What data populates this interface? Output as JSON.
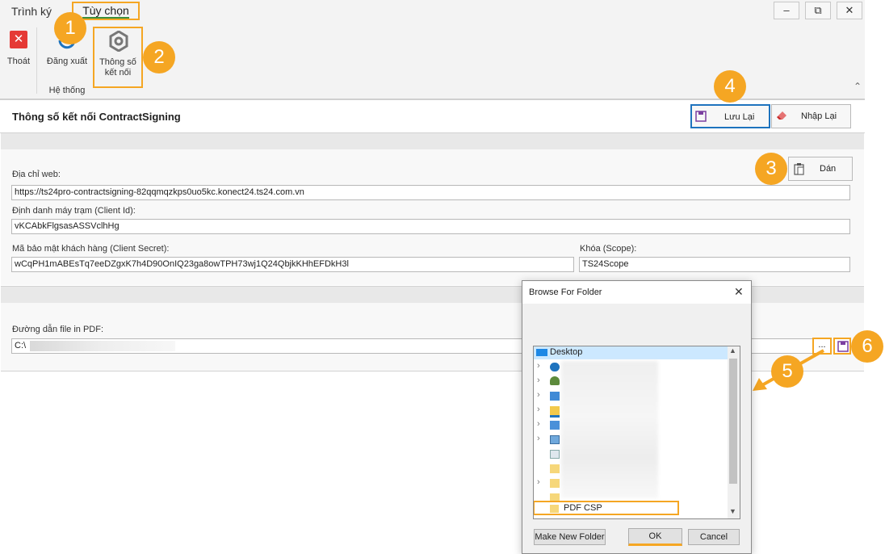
{
  "ribbon": {
    "tabs": [
      "Trình ký",
      "Tùy chọn"
    ],
    "exit_label": "Thoát",
    "logout_label": "Đăng xuất",
    "connection_label_line1": "Thông số",
    "connection_label_line2": "kết nối",
    "group_label": "Hệ thống",
    "window_buttons": [
      "–",
      "⧉",
      "✕"
    ],
    "collapse_glyph": "⌃"
  },
  "panel": {
    "title": "Thông số kết nối ContractSigning",
    "save_label": "Lưu Lại",
    "reset_label": "Nhập Lại",
    "paste_label": "Dán",
    "web_address_label": "Địa chỉ web:",
    "web_address_value": "https://ts24pro-contractsigning-82qqmqzkps0uo5kc.konect24.ts24.com.vn",
    "client_id_label": "Định danh máy trạm (Client Id):",
    "client_id_value": "vKCAbkFlgsasASSVclhHg",
    "client_secret_label": "Mã bảo mật khách hàng (Client Secret):",
    "client_secret_value": "wCqPH1mABEsTq7eeDZgxK7h4D90OnIQ23ga8owTPH73wj1Q24QbjkKHhEFDkH3l",
    "scope_label": "Khóa (Scope):",
    "scope_value": "TS24Scope",
    "pdf_path_label": "Đường dẫn file in PDF:",
    "pdf_path_value": "C:\\",
    "browse_glyph": "..."
  },
  "dialog": {
    "title": "Browse For Folder",
    "close_glyph": "✕",
    "root_label": "Desktop",
    "folder_label": "PDF CSP",
    "make_new_folder_label": "Make New Folder",
    "ok_label": "OK",
    "cancel_label": "Cancel"
  },
  "badges": [
    "1",
    "2",
    "3",
    "4",
    "5",
    "6"
  ],
  "colors": {
    "highlight": "#f5a623",
    "exit_red": "#e53935",
    "accent_blue": "#1e73be"
  }
}
